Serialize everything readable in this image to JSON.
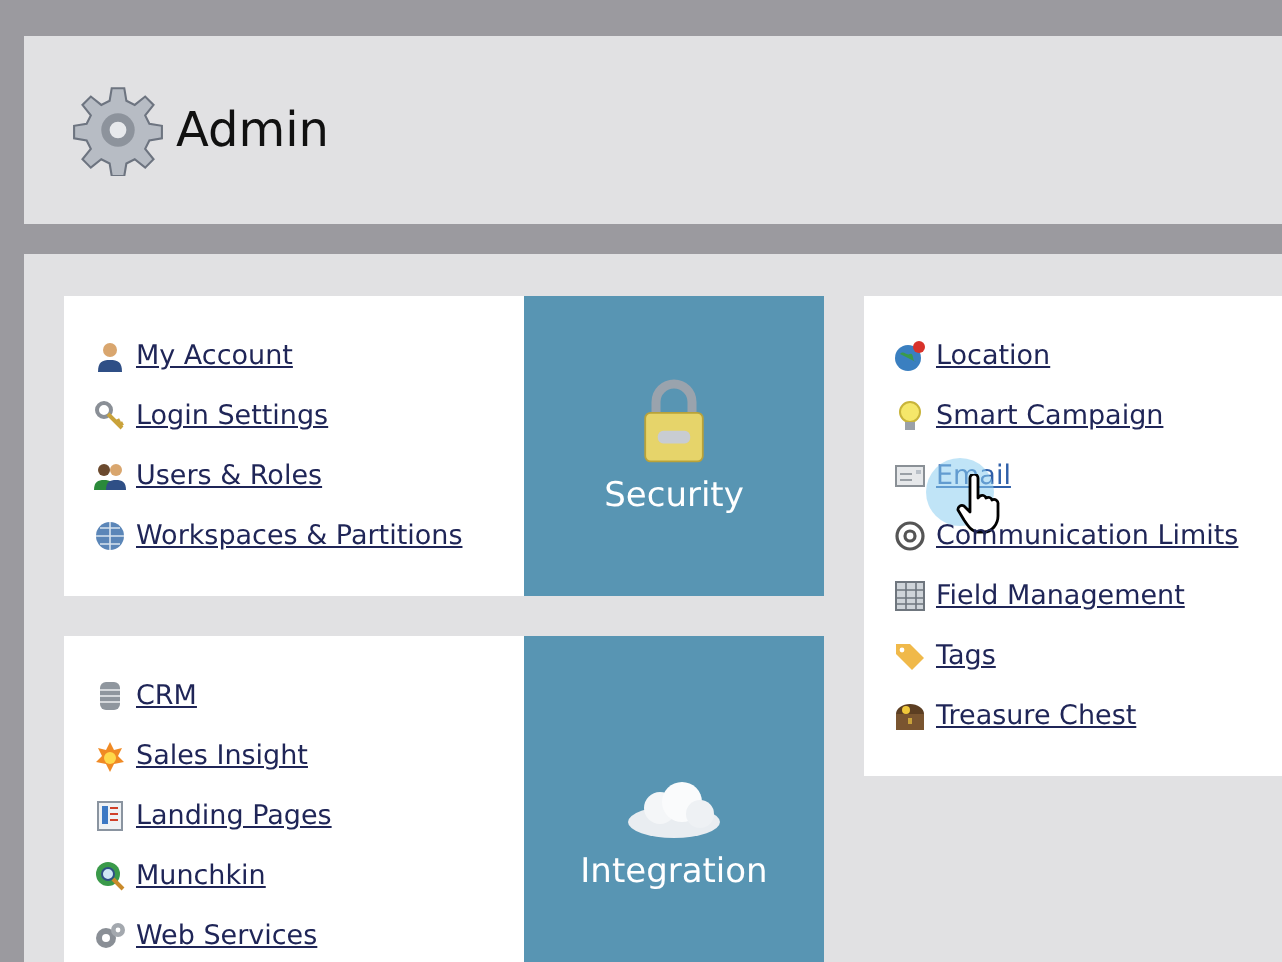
{
  "header": {
    "title": "Admin"
  },
  "sections": [
    {
      "tile": "Security",
      "links": [
        {
          "label": "My Account",
          "hovered": false
        },
        {
          "label": "Login Settings",
          "hovered": false
        },
        {
          "label": "Users & Roles",
          "hovered": false
        },
        {
          "label": "Workspaces & Partitions",
          "hovered": false
        }
      ]
    },
    {
      "tile": "Integration",
      "links": [
        {
          "label": "CRM",
          "hovered": false
        },
        {
          "label": "Sales Insight",
          "hovered": false
        },
        {
          "label": "Landing Pages",
          "hovered": false
        },
        {
          "label": "Munchkin",
          "hovered": false
        },
        {
          "label": "Web Services",
          "hovered": false
        }
      ]
    }
  ],
  "right_links": [
    {
      "label": "Location",
      "hovered": false
    },
    {
      "label": "Smart Campaign",
      "hovered": false
    },
    {
      "label": "Email",
      "hovered": true
    },
    {
      "label": "Communication Limits",
      "hovered": false
    },
    {
      "label": "Field Management",
      "hovered": false
    },
    {
      "label": "Tags",
      "hovered": false
    },
    {
      "label": "Treasure Chest",
      "hovered": false
    }
  ]
}
